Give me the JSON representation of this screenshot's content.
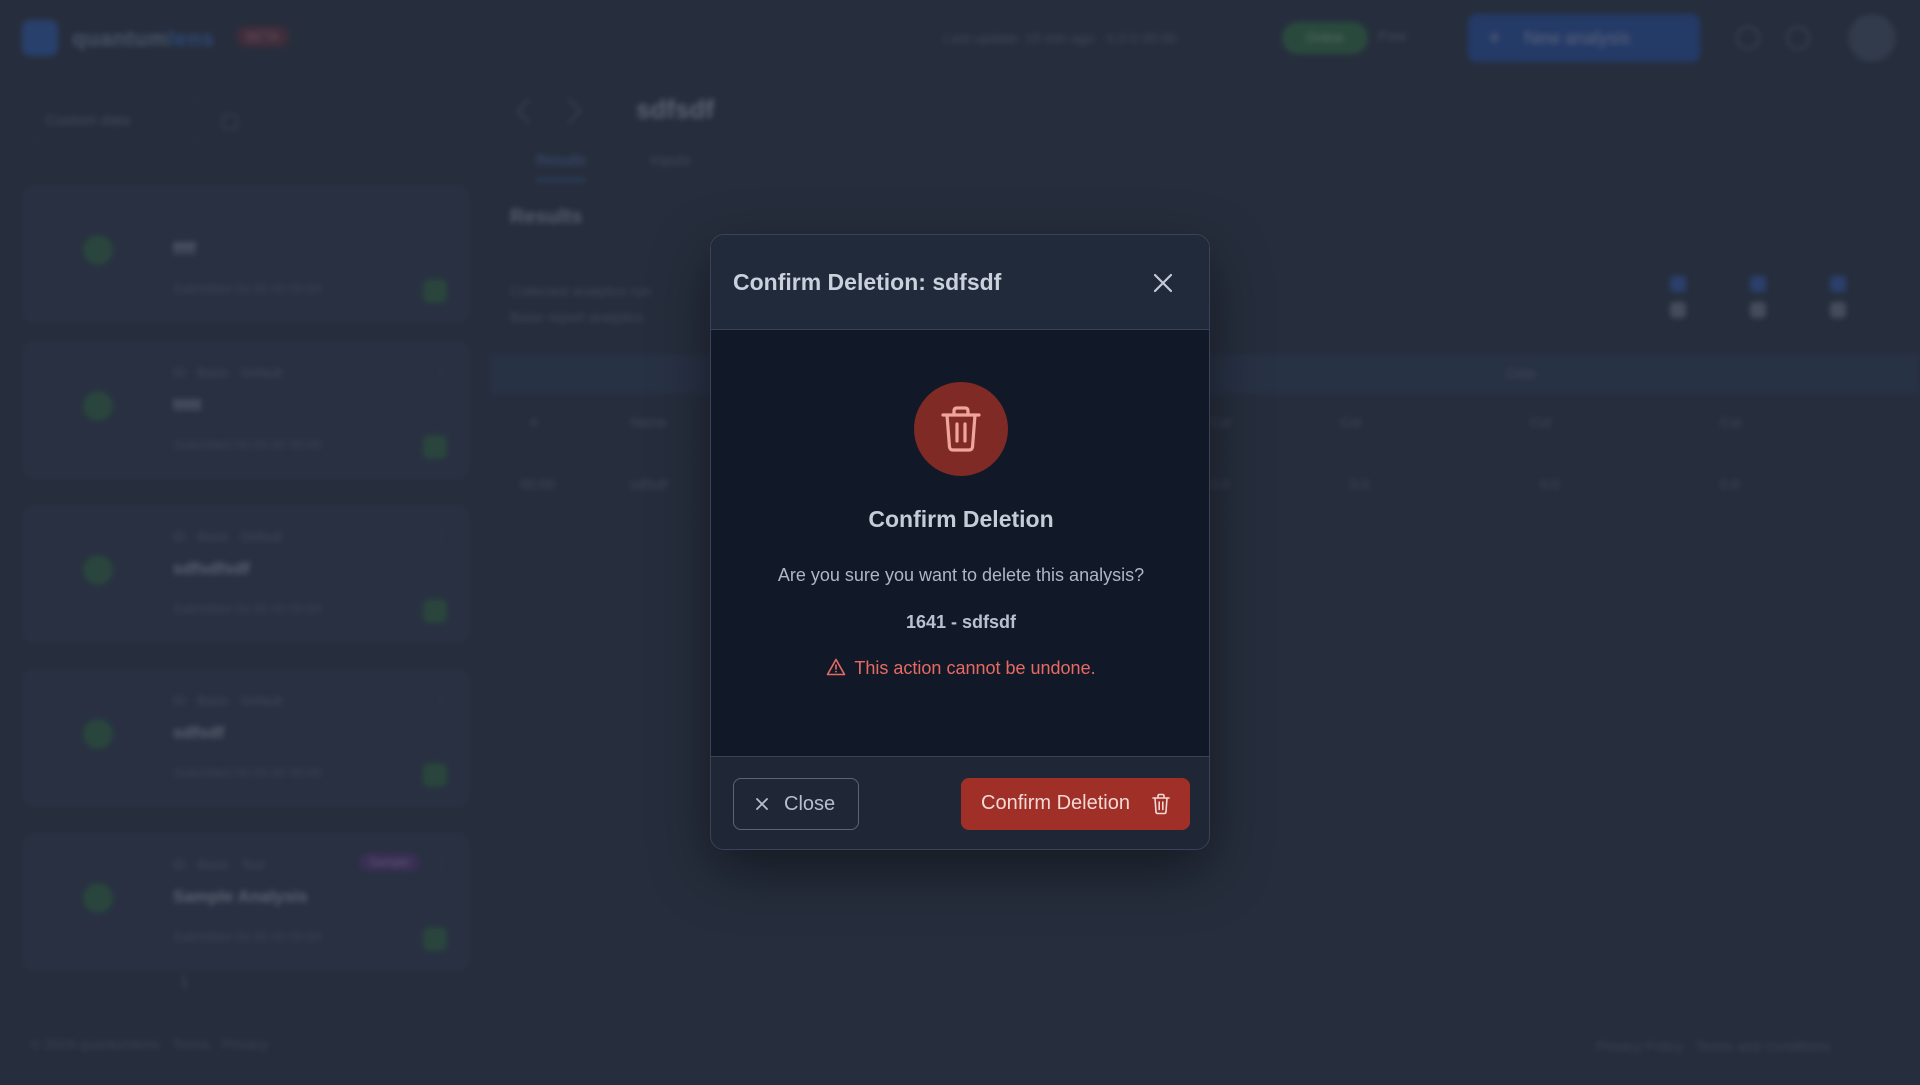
{
  "app": {
    "logo_text_a": "quantum",
    "logo_text_b": "lens",
    "beta_badge": "BETA",
    "last_update": "Last update: 15 min ago · 0.0.0 00:00",
    "status_pill": "Online",
    "status_text": "Free",
    "new_analysis_label": "New analysis"
  },
  "sidebar": {
    "filter_label": "Custom data",
    "cards": [
      {
        "meta": "",
        "name": "ffff",
        "date": "Submitted 00.00.00 00:00"
      },
      {
        "meta": "ID · Basic · Default",
        "name": "ttttt",
        "date": "Submitted 00.00.00 00:00"
      },
      {
        "meta": "ID · Basic · Default",
        "name": "sdfsdfsdf",
        "date": "Submitted 00.00.00 00:00"
      },
      {
        "meta": "ID · Basic · Default",
        "name": "sdfsdf",
        "date": "Submitted 00.00.00 00:00"
      },
      {
        "meta": "ID · Basic · Test",
        "name": "Sample Analysis",
        "date": "Submitted 00.00.00 00:00",
        "tag": "Sample"
      }
    ],
    "pager": "1",
    "footer": "© 2024 quantumlens · Terms · Privacy"
  },
  "main": {
    "title": "sdfsdf",
    "tabs": [
      "Results",
      "Inputs"
    ],
    "results_heading": "Results",
    "results_sub_1": "Collected analytics run",
    "results_sub_2": "Basic report analytics",
    "table_bar_label": "Data",
    "columns": [
      "#",
      "Name",
      "Col",
      "Col",
      "Col",
      "Col"
    ],
    "row_cells": [
      "00:00",
      "sdfsdf",
      "0.0",
      "0.0",
      "0.0",
      "0.0"
    ],
    "footer_right": "Privacy Policy · Terms and Conditions"
  },
  "modal": {
    "title": "Confirm Deletion: sdfsdf",
    "heading": "Confirm Deletion",
    "question": "Are you sure you want to delete this analysis?",
    "item": "1641 - sdfsdf",
    "warning": "This action cannot be undone.",
    "close_label": "Close",
    "confirm_label": "Confirm Deletion"
  },
  "colors": {
    "danger": "#a02f28",
    "danger_text": "#e86b62",
    "modal_bg": "#111827",
    "backdrop": "#333c4d"
  },
  "icons": [
    "close-icon",
    "trash-icon",
    "warning-icon"
  ]
}
